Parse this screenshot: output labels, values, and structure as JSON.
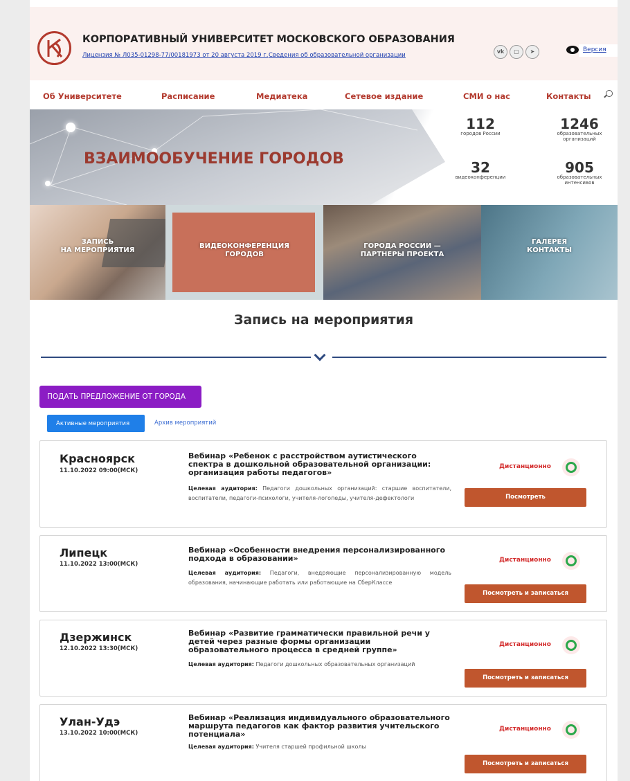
{
  "header": {
    "org_title": "КОРПОРАТИВНЫЙ УНИВЕРСИТЕТ МОСКОВСКОГО ОБРАЗОВАНИЯ",
    "license": "Лицензия № Л035-01298-77/00181973 от 20 августа 2019 г.",
    "org_info": "Сведения об образовательной организации",
    "social": [
      "vk-icon",
      "window-icon",
      "telegram-icon"
    ],
    "version_label": "Версия"
  },
  "nav": {
    "items": [
      "Об Университете",
      "Расписание",
      "Медиатека",
      "Сетевое издание",
      "СМИ о нас",
      "Контакты"
    ]
  },
  "hero": {
    "title": "ВЗАИМООБУЧЕНИЕ ГОРОДОВ",
    "stats": [
      {
        "value": "112",
        "label": "городов России"
      },
      {
        "value": "1246",
        "label": "образовательных организаций"
      },
      {
        "value": "32",
        "label": "видеоконференции"
      },
      {
        "value": "905",
        "label": "образовательных интенсивов"
      }
    ]
  },
  "tiles": [
    {
      "line1": "ЗАПИСЬ",
      "line2": "НА МЕРОПРИЯТИЯ"
    },
    {
      "line1": "ВИДЕОКОНФЕРЕНЦИЯ",
      "line2": "ГОРОДОВ"
    },
    {
      "line1": "ГОРОДА РОССИИ —",
      "line2": "ПАРТНЕРЫ ПРОЕКТА"
    },
    {
      "line1": "ГАЛЕРЕЯ",
      "line2": "КОНТАКТЫ"
    }
  ],
  "section": {
    "title": "Запись на мероприятия",
    "propose_btn": "ПОДАТЬ ПРЕДЛОЖЕНИЕ ОТ ГОРОДА",
    "tab_active": "Активные мероприятия",
    "tab_archive": "Архив мероприятий"
  },
  "audience_label": "Целевая аудитория:",
  "events": [
    {
      "city": "Красноярск",
      "date": "11.10.2022 09:00(МСК)",
      "title": "Вебинар «Ребенок с расстройством аутистического спектра в дошкольной образовательной организации: организация работы педагогов»",
      "audience": "Педагоги дошкольных организаций: старшие воспитатели, воспитатели, педагоги-психологи, учителя-логопеды, учителя-дефектологи",
      "format": "Дистанционно",
      "button": "Посмотреть"
    },
    {
      "city": "Липецк",
      "date": "11.10.2022 13:00(МСК)",
      "title": "Вебинар «Особенности внедрения персонализированного подхода в образовании»",
      "audience": "Педагоги, внедряющие персонализированную модель образования, начинающие работать или работающие на СберКлассе",
      "format": "Дистанционно",
      "button": "Посмотреть и записаться"
    },
    {
      "city": "Дзержинск",
      "date": "12.10.2022 13:30(МСК)",
      "title": "Вебинар «Развитие грамматически правильной речи у детей через разные формы организации образовательного процесса в средней группе»",
      "audience": "Педагоги дошкольных образовательных организаций",
      "format": "Дистанционно",
      "button": "Посмотреть и записаться"
    },
    {
      "city": "Улан-Удэ",
      "date": "13.10.2022 10:00(МСК)",
      "title": "Вебинар «Реализация индивидуального образовательного маршрута педагогов как фактор развития учительского потенциала»",
      "audience": "Учителя старшей профильной школы",
      "format": "Дистанционно",
      "button": "Посмотреть и записаться"
    }
  ]
}
